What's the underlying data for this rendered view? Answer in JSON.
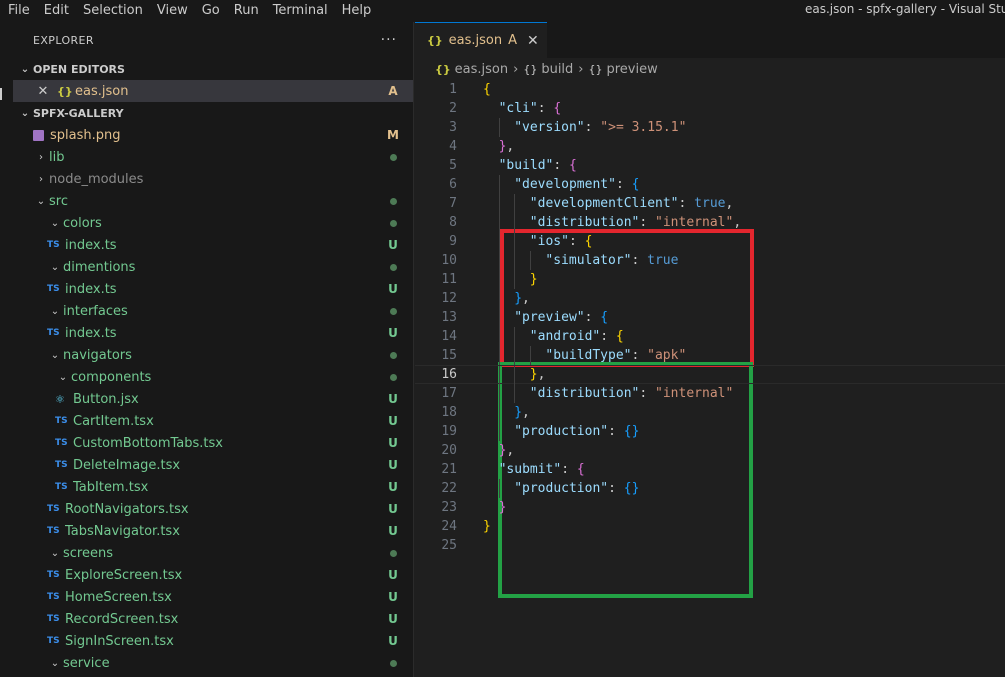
{
  "menu": [
    "File",
    "Edit",
    "Selection",
    "View",
    "Go",
    "Run",
    "Terminal",
    "Help"
  ],
  "window_title": "eas.json - spfx-gallery - Visual Studio Code",
  "sidebar": {
    "title": "EXPLORER",
    "more_icon": "ellipsis-icon",
    "open_editors_label": "OPEN EDITORS",
    "open_editor": {
      "name": "eas.json",
      "badge": "A"
    },
    "workspace_label": "SPFX-GALLERY",
    "tree": [
      {
        "name": "splash.png",
        "indent": 1,
        "kind": "image",
        "badge": "M",
        "color": "#e2c08d"
      },
      {
        "name": "lib",
        "indent": 1,
        "kind": "folder",
        "badge": "dot",
        "color": "#73c991",
        "chevron": "›"
      },
      {
        "name": "node_modules",
        "indent": 1,
        "kind": "folder",
        "badge": "",
        "color": "#8b8b8b",
        "chevron": "›"
      },
      {
        "name": "src",
        "indent": 1,
        "kind": "folder",
        "badge": "dot",
        "color": "#73c991",
        "chevron": "⌄"
      },
      {
        "name": "colors",
        "indent": 2,
        "kind": "folder",
        "badge": "dot",
        "color": "#73c991",
        "chevron": "⌄"
      },
      {
        "name": "index.ts",
        "indent": 2,
        "kind": "ts",
        "badge": "U",
        "color": "#73c991"
      },
      {
        "name": "dimentions",
        "indent": 2,
        "kind": "folder",
        "badge": "dot",
        "color": "#73c991",
        "chevron": "⌄"
      },
      {
        "name": "index.ts",
        "indent": 2,
        "kind": "ts",
        "badge": "U",
        "color": "#73c991"
      },
      {
        "name": "interfaces",
        "indent": 2,
        "kind": "folder",
        "badge": "dot",
        "color": "#73c991",
        "chevron": "⌄"
      },
      {
        "name": "index.ts",
        "indent": 2,
        "kind": "ts",
        "badge": "U",
        "color": "#73c991"
      },
      {
        "name": "navigators",
        "indent": 2,
        "kind": "folder",
        "badge": "dot",
        "color": "#73c991",
        "chevron": "⌄"
      },
      {
        "name": "components",
        "indent": 3,
        "kind": "folder",
        "badge": "dot",
        "color": "#73c991",
        "chevron": "⌄"
      },
      {
        "name": "Button.jsx",
        "indent": 3,
        "kind": "react",
        "badge": "U",
        "color": "#73c991"
      },
      {
        "name": "CartItem.tsx",
        "indent": 3,
        "kind": "ts",
        "badge": "U",
        "color": "#73c991"
      },
      {
        "name": "CustomBottomTabs.tsx",
        "indent": 3,
        "kind": "ts",
        "badge": "U",
        "color": "#73c991"
      },
      {
        "name": "DeleteImage.tsx",
        "indent": 3,
        "kind": "ts",
        "badge": "U",
        "color": "#73c991"
      },
      {
        "name": "TabItem.tsx",
        "indent": 3,
        "kind": "ts",
        "badge": "U",
        "color": "#73c991"
      },
      {
        "name": "RootNavigators.tsx",
        "indent": 2,
        "kind": "ts",
        "badge": "U",
        "color": "#73c991"
      },
      {
        "name": "TabsNavigator.tsx",
        "indent": 2,
        "kind": "ts",
        "badge": "U",
        "color": "#73c991"
      },
      {
        "name": "screens",
        "indent": 2,
        "kind": "folder",
        "badge": "dot",
        "color": "#73c991",
        "chevron": "⌄"
      },
      {
        "name": "ExploreScreen.tsx",
        "indent": 2,
        "kind": "ts",
        "badge": "U",
        "color": "#73c991"
      },
      {
        "name": "HomeScreen.tsx",
        "indent": 2,
        "kind": "ts",
        "badge": "U",
        "color": "#73c991"
      },
      {
        "name": "RecordScreen.tsx",
        "indent": 2,
        "kind": "ts",
        "badge": "U",
        "color": "#73c991"
      },
      {
        "name": "SignInScreen.tsx",
        "indent": 2,
        "kind": "ts",
        "badge": "U",
        "color": "#73c991"
      },
      {
        "name": "service",
        "indent": 2,
        "kind": "folder",
        "badge": "dot",
        "color": "#73c991",
        "chevron": "⌄"
      }
    ]
  },
  "editor": {
    "tab": {
      "name": "eas.json",
      "badge": "A",
      "close_icon": "close-icon"
    },
    "breadcrumbs": [
      "eas.json",
      "build",
      "preview"
    ],
    "current_line": 16,
    "lines": [
      {
        "n": 1,
        "indent": 0,
        "tokens": [
          [
            "b1",
            "{"
          ]
        ]
      },
      {
        "n": 2,
        "indent": 1,
        "tokens": [
          [
            "key",
            "\"cli\""
          ],
          [
            "punc",
            ": "
          ],
          [
            "b2",
            "{"
          ]
        ]
      },
      {
        "n": 3,
        "indent": 2,
        "tokens": [
          [
            "key",
            "\"version\""
          ],
          [
            "punc",
            ": "
          ],
          [
            "str",
            "\">= 3.15.1\""
          ]
        ]
      },
      {
        "n": 4,
        "indent": 1,
        "tokens": [
          [
            "b2",
            "}"
          ],
          [
            "punc",
            ","
          ]
        ]
      },
      {
        "n": 5,
        "indent": 1,
        "tokens": [
          [
            "key",
            "\"build\""
          ],
          [
            "punc",
            ": "
          ],
          [
            "b2",
            "{"
          ]
        ]
      },
      {
        "n": 6,
        "indent": 2,
        "tokens": [
          [
            "key",
            "\"development\""
          ],
          [
            "punc",
            ": "
          ],
          [
            "b3",
            "{"
          ]
        ]
      },
      {
        "n": 7,
        "indent": 3,
        "tokens": [
          [
            "key",
            "\"developmentClient\""
          ],
          [
            "punc",
            ": "
          ],
          [
            "bool",
            "true"
          ],
          [
            "punc",
            ","
          ]
        ]
      },
      {
        "n": 8,
        "indent": 3,
        "tokens": [
          [
            "key",
            "\"distribution\""
          ],
          [
            "punc",
            ": "
          ],
          [
            "str",
            "\"internal\""
          ],
          [
            "punc",
            ","
          ]
        ]
      },
      {
        "n": 9,
        "indent": 3,
        "tokens": [
          [
            "key",
            "\"ios\""
          ],
          [
            "punc",
            ": "
          ],
          [
            "b1",
            "{"
          ]
        ]
      },
      {
        "n": 10,
        "indent": 4,
        "tokens": [
          [
            "key",
            "\"simulator\""
          ],
          [
            "punc",
            ": "
          ],
          [
            "bool",
            "true"
          ]
        ]
      },
      {
        "n": 11,
        "indent": 3,
        "tokens": [
          [
            "b1",
            "}"
          ]
        ]
      },
      {
        "n": 12,
        "indent": 2,
        "tokens": [
          [
            "b3",
            "}"
          ],
          [
            "punc",
            ","
          ]
        ]
      },
      {
        "n": 13,
        "indent": 2,
        "tokens": [
          [
            "key",
            "\"preview\""
          ],
          [
            "punc",
            ": "
          ],
          [
            "b3",
            "{"
          ]
        ]
      },
      {
        "n": 14,
        "indent": 3,
        "tokens": [
          [
            "key",
            "\"android\""
          ],
          [
            "punc",
            ": "
          ],
          [
            "b1",
            "{"
          ]
        ]
      },
      {
        "n": 15,
        "indent": 4,
        "tokens": [
          [
            "key",
            "\"buildType\""
          ],
          [
            "punc",
            ": "
          ],
          [
            "str",
            "\"apk\""
          ]
        ]
      },
      {
        "n": 16,
        "indent": 3,
        "tokens": [
          [
            "b1",
            "}"
          ],
          [
            "punc",
            ","
          ]
        ]
      },
      {
        "n": 17,
        "indent": 3,
        "tokens": [
          [
            "key",
            "\"distribution\""
          ],
          [
            "punc",
            ": "
          ],
          [
            "str",
            "\"internal\""
          ]
        ]
      },
      {
        "n": 18,
        "indent": 2,
        "tokens": [
          [
            "b3",
            "}"
          ],
          [
            "punc",
            ","
          ]
        ]
      },
      {
        "n": 19,
        "indent": 2,
        "tokens": [
          [
            "key",
            "\"production\""
          ],
          [
            "punc",
            ": "
          ],
          [
            "b3",
            "{}"
          ]
        ]
      },
      {
        "n": 20,
        "indent": 1,
        "tokens": [
          [
            "b2",
            "}"
          ],
          [
            "punc",
            ","
          ]
        ]
      },
      {
        "n": 21,
        "indent": 1,
        "tokens": [
          [
            "key",
            "\"submit\""
          ],
          [
            "punc",
            ": "
          ],
          [
            "b2",
            "{"
          ]
        ]
      },
      {
        "n": 22,
        "indent": 2,
        "tokens": [
          [
            "key",
            "\"production\""
          ],
          [
            "punc",
            ": "
          ],
          [
            "b3",
            "{}"
          ]
        ]
      },
      {
        "n": 23,
        "indent": 1,
        "tokens": [
          [
            "b2",
            "}"
          ]
        ]
      },
      {
        "n": 24,
        "indent": 0,
        "tokens": [
          [
            "b1",
            "}"
          ]
        ]
      },
      {
        "n": 25,
        "indent": 0,
        "tokens": []
      }
    ]
  },
  "annotations": {
    "red_box_color": "#e3262e",
    "green_box_color": "#23a145"
  }
}
